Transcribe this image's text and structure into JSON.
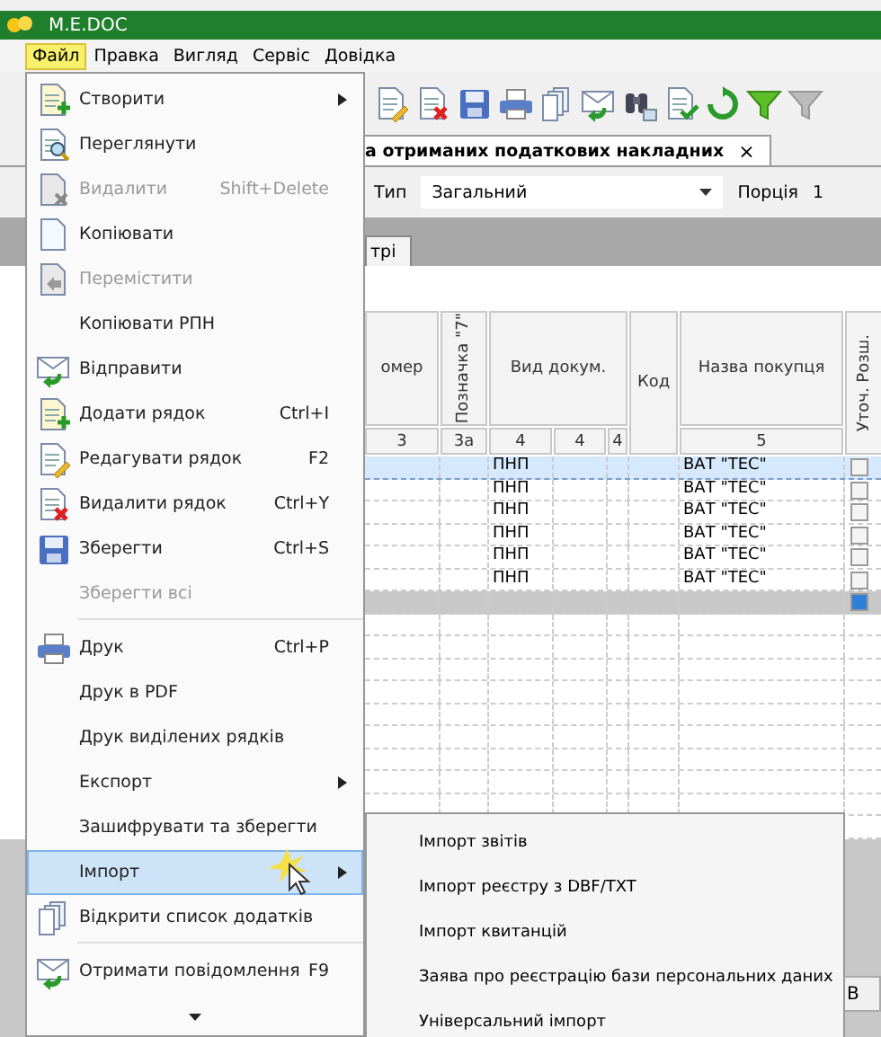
{
  "window": {
    "title": "M.E.DOC"
  },
  "menu_bar": [
    {
      "label": "Файл",
      "selected": true
    },
    {
      "label": "Правка",
      "selected": false
    },
    {
      "label": "Вигляд",
      "selected": false
    },
    {
      "label": "Сервіс",
      "selected": false
    },
    {
      "label": "Довідка",
      "selected": false
    }
  ],
  "document_tab": {
    "label": "а отриманих податкових накладних",
    "close": "×"
  },
  "filter_bar": {
    "type_label": "Тип",
    "type_value": "Загальний",
    "portion_label": "Порція",
    "portion_value": "1"
  },
  "sub_tab": {
    "label": "трі"
  },
  "table": {
    "header": {
      "column_1": "омер",
      "mark_7": "Позначка \"7\"",
      "doc_kind": "Вид докум.",
      "code": "Код",
      "buyer": "Назва покупця",
      "column_8": "Уточ. Розш."
    },
    "column_numbers": [
      "3",
      "3а",
      "4",
      "4",
      "4",
      "5"
    ],
    "rows": [
      {
        "doc_kind": "ПНП",
        "buyer": "ВАТ \"ТЕС\"",
        "checked": false,
        "selected": true
      },
      {
        "doc_kind": "ПНП",
        "buyer": "ВАТ \"ТЕС\"",
        "checked": false,
        "selected": false
      },
      {
        "doc_kind": "ПНП",
        "buyer": "ВАТ \"ТЕС\"",
        "checked": false,
        "selected": false
      },
      {
        "doc_kind": "ПНП",
        "buyer": "ВАТ \"ТЕС\"",
        "checked": false,
        "selected": false
      },
      {
        "doc_kind": "ПНП",
        "buyer": "ВАТ \"ТЕС\"",
        "checked": false,
        "selected": false
      },
      {
        "doc_kind": "ПНП",
        "buyer": "ВАТ \"ТЕС\"",
        "checked": false,
        "selected": false
      }
    ],
    "summary_row": {
      "checked": true
    }
  },
  "bottom_button": "В",
  "file_menu": [
    {
      "kind": "item",
      "label": "Створити",
      "submenu": true,
      "disabled": false,
      "selected": false
    },
    {
      "kind": "item",
      "label": "Переглянути",
      "submenu": false,
      "disabled": false,
      "selected": false
    },
    {
      "kind": "item",
      "label": "Видалити",
      "shortcut": "Shift+Delete",
      "submenu": false,
      "disabled": true,
      "selected": false
    },
    {
      "kind": "item",
      "label": "Копіювати",
      "submenu": false,
      "disabled": false,
      "selected": false
    },
    {
      "kind": "item",
      "label": "Перемістити",
      "submenu": false,
      "disabled": true,
      "selected": false
    },
    {
      "kind": "item",
      "label": "Копіювати РПН",
      "submenu": false,
      "disabled": false,
      "selected": false
    },
    {
      "kind": "item",
      "label": "Відправити",
      "submenu": false,
      "disabled": false,
      "selected": false
    },
    {
      "kind": "item",
      "label": "Додати рядок",
      "shortcut": "Ctrl+I",
      "submenu": false,
      "disabled": false,
      "selected": false
    },
    {
      "kind": "item",
      "label": "Редагувати рядок",
      "shortcut": "F2",
      "submenu": false,
      "disabled": false,
      "selected": false
    },
    {
      "kind": "item",
      "label": "Видалити рядок",
      "shortcut": "Ctrl+Y",
      "submenu": false,
      "disabled": false,
      "selected": false
    },
    {
      "kind": "item",
      "label": "Зберегти",
      "shortcut": "Ctrl+S",
      "submenu": false,
      "disabled": false,
      "selected": false
    },
    {
      "kind": "item",
      "label": "Зберегти всі",
      "submenu": false,
      "disabled": true,
      "selected": false
    },
    {
      "kind": "separator"
    },
    {
      "kind": "item",
      "label": "Друк",
      "shortcut": "Ctrl+P",
      "submenu": false,
      "disabled": false,
      "selected": false
    },
    {
      "kind": "item",
      "label": "Друк в PDF",
      "submenu": false,
      "disabled": false,
      "selected": false
    },
    {
      "kind": "item",
      "label": "Друк виділених рядків",
      "submenu": false,
      "disabled": false,
      "selected": false
    },
    {
      "kind": "item",
      "label": "Експорт",
      "submenu": true,
      "disabled": false,
      "selected": false
    },
    {
      "kind": "item",
      "label": "Зашифрувати та зберегти",
      "submenu": false,
      "disabled": false,
      "selected": false
    },
    {
      "kind": "item",
      "label": "Імпорт",
      "submenu": true,
      "disabled": false,
      "selected": true
    },
    {
      "kind": "item",
      "label": "Відкрити список додатків",
      "submenu": false,
      "disabled": false,
      "selected": false
    },
    {
      "kind": "separator"
    },
    {
      "kind": "item",
      "label": "Отримати повідомлення",
      "shortcut": "F9",
      "submenu": false,
      "disabled": false,
      "selected": false
    },
    {
      "kind": "scroll-down"
    }
  ],
  "import_submenu": [
    {
      "label": "Імпорт звітів"
    },
    {
      "label": "Імпорт реєстру з DBF/TXT"
    },
    {
      "label": "Імпорт квитанцій"
    },
    {
      "label": "Заява про реєстрацію бази персональних даних"
    },
    {
      "label": "Універсальний імпорт"
    }
  ]
}
